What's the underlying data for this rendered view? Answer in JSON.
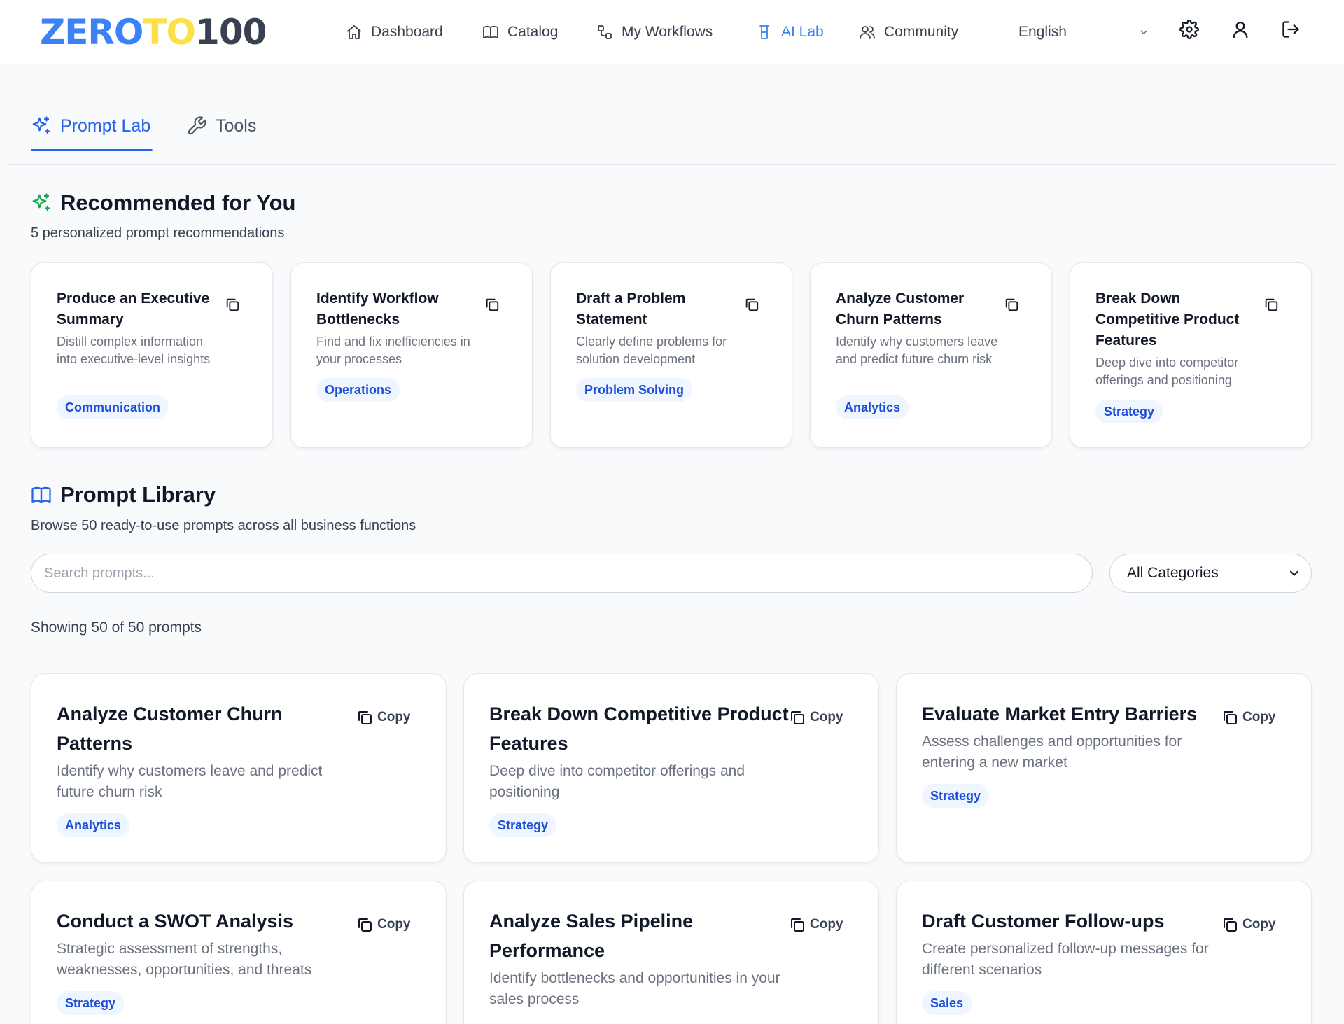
{
  "brand": {
    "part1": "ZERO",
    "part2": "TO",
    "part3": "100"
  },
  "nav": {
    "items": [
      {
        "label": "Dashboard",
        "icon": "home-icon"
      },
      {
        "label": "Catalog",
        "icon": "book-icon"
      },
      {
        "label": "My Workflows",
        "icon": "workflow-icon"
      },
      {
        "label": "AI Lab",
        "icon": "flask-icon",
        "active": true
      },
      {
        "label": "Community",
        "icon": "users-icon"
      }
    ],
    "language": "English"
  },
  "tabs": [
    {
      "label": "Prompt Lab",
      "icon": "sparkles-icon",
      "active": true
    },
    {
      "label": "Tools",
      "icon": "wrench-icon"
    }
  ],
  "recommended": {
    "title": "Recommended for You",
    "subtitle": "5 personalized prompt recommendations",
    "cards": [
      {
        "title": "Produce an Executive Summary",
        "desc": "Distill complex information into executive-level insights",
        "tag": "Communication"
      },
      {
        "title": "Identify Workflow Bottlenecks",
        "desc": "Find and fix inefficiencies in your processes",
        "tag": "Operations"
      },
      {
        "title": "Draft a Problem Statement",
        "desc": "Clearly define problems for solution development",
        "tag": "Problem Solving"
      },
      {
        "title": "Analyze Customer Churn Patterns",
        "desc": "Identify why customers leave and predict future churn risk",
        "tag": "Analytics"
      },
      {
        "title": "Break Down Competitive Product Features",
        "desc": "Deep dive into competitor offerings and positioning",
        "tag": "Strategy"
      }
    ]
  },
  "library": {
    "title": "Prompt Library",
    "subtitle": "Browse 50 ready-to-use prompts across all business functions",
    "search_placeholder": "Search prompts...",
    "category_selected": "All Categories",
    "count_text": "Showing 50 of 50 prompts",
    "copy_label": "Copy",
    "cards": [
      {
        "title": "Analyze Customer Churn Patterns",
        "desc": "Identify why customers leave and predict future churn risk",
        "tag": "Analytics"
      },
      {
        "title": "Break Down Competitive Product Features",
        "desc": "Deep dive into competitor offerings and positioning",
        "tag": "Strategy"
      },
      {
        "title": "Evaluate Market Entry Barriers",
        "desc": "Assess challenges and opportunities for entering a new market",
        "tag": "Strategy"
      },
      {
        "title": "Conduct a SWOT Analysis",
        "desc": "Strategic assessment of strengths, weaknesses, opportunities, and threats",
        "tag": "Strategy"
      },
      {
        "title": "Analyze Sales Pipeline Performance",
        "desc": "Identify bottlenecks and opportunities in your sales process",
        "tag": ""
      },
      {
        "title": "Draft Customer Follow-ups",
        "desc": "Create personalized follow-up messages for different scenarios",
        "tag": "Sales"
      }
    ]
  },
  "colors": {
    "accent": "#2563eb",
    "background": "#f8fafc",
    "badge_bg": "#eff6ff",
    "success_icon": "#16a34a"
  }
}
